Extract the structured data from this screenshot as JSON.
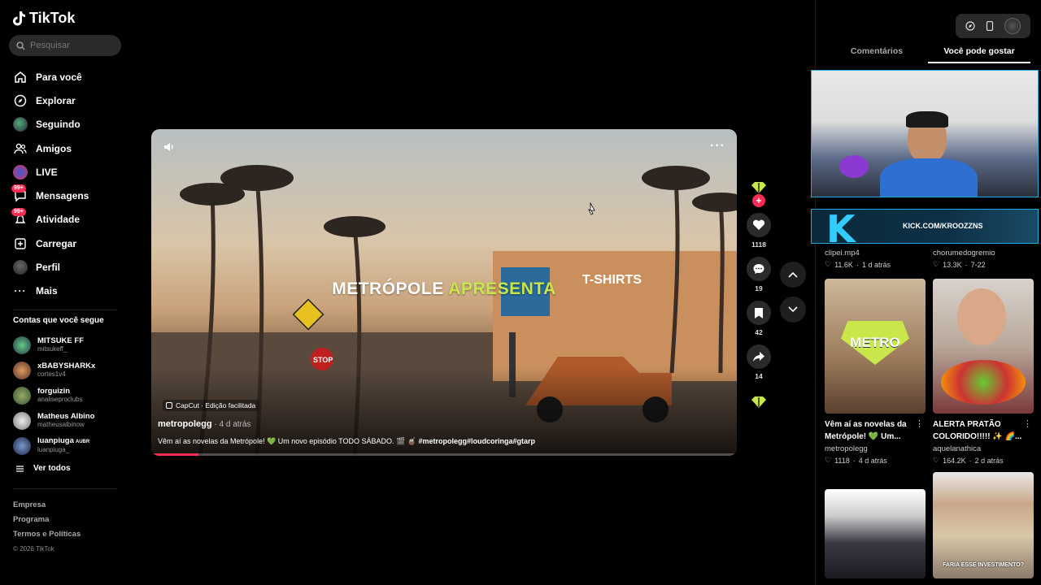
{
  "app": {
    "brand": "TikTok"
  },
  "search": {
    "placeholder": "Pesquisar"
  },
  "nav": {
    "items": [
      {
        "label": "Para você",
        "icon": "home-icon"
      },
      {
        "label": "Explorar",
        "icon": "compass-icon"
      },
      {
        "label": "Seguindo",
        "icon": "following-avatar-icon"
      },
      {
        "label": "Amigos",
        "icon": "friends-icon"
      },
      {
        "label": "LIVE",
        "icon": "live-icon"
      },
      {
        "label": "Mensagens",
        "icon": "messages-icon",
        "badge": "99+"
      },
      {
        "label": "Atividade",
        "icon": "activity-icon",
        "badge": "99+"
      },
      {
        "label": "Carregar",
        "icon": "upload-icon"
      },
      {
        "label": "Perfil",
        "icon": "profile-icon"
      },
      {
        "label": "Mais",
        "icon": "more-icon"
      }
    ]
  },
  "following": {
    "title": "Contas que você segue",
    "accounts": [
      {
        "name": "MITSUKE FF",
        "handle": "mitsukeff_"
      },
      {
        "name": "xBABYSHARKx",
        "handle": "cortes1v4"
      },
      {
        "name": "forguizin",
        "handle": "analiseproclubs"
      },
      {
        "name": "Matheus Albino",
        "handle": "matheusalbinow"
      },
      {
        "name": "luanpiuga",
        "name_tag": "AUBR",
        "handle": "luanpiuga_"
      }
    ],
    "see_all": "Ver todos"
  },
  "footer": {
    "links": [
      "Empresa",
      "Programa",
      "Termos e Políticas"
    ],
    "copyright": "© 2026 TikTok"
  },
  "video": {
    "overlay_title_a": "METRÓPOLE",
    "overlay_title_b": "APRESENTA",
    "capcut": "CapCut · Edição facilitada",
    "author": "metropolegg",
    "time": " · 4 d atrás",
    "caption": "Vêm aí as novelas da Metrópole! 💚 Um novo episódio TODO SÁBADO. 🎬 🧉",
    "hashtags": "#metropolegg#loudcoringa#gtarp",
    "progress": 0.08
  },
  "actions": {
    "likes": "1118",
    "comments": "19",
    "saves": "42",
    "shares": "14"
  },
  "right_panel": {
    "tabs": [
      "Comentários",
      "Você pode gostar"
    ],
    "active_tab": 1,
    "kick_url": "KICK.COM/KROOZZNS",
    "cards": [
      {
        "title": "",
        "author": "clipei.mp4",
        "likes": "11.6K",
        "time": "1 d atrás"
      },
      {
        "title": "",
        "author": "chorumedogremio",
        "likes": "13.3K",
        "time": "7-22"
      },
      {
        "title": "Vêm aí as novelas da Metrópole! 💚 Um...",
        "author": "metropolegg",
        "likes": "1118",
        "time": "4 d atrás",
        "thumb_text": "METRO"
      },
      {
        "title": "ALERTA PRATÃO COLORIDO!!!!! ✨ 🌈...",
        "author": "aquelanathica",
        "likes": "164.2K",
        "time": "2 d atrás"
      },
      {
        "title": "",
        "author": "",
        "likes": "",
        "time": ""
      },
      {
        "title": "",
        "author": "",
        "likes": "",
        "time": "",
        "thumb_text": "FARIA ESSE INVESTIMENTO?"
      }
    ]
  },
  "colors": {
    "accent": "#fe2c55",
    "highlight": "#c9e64a",
    "kick": "#33ccff"
  }
}
